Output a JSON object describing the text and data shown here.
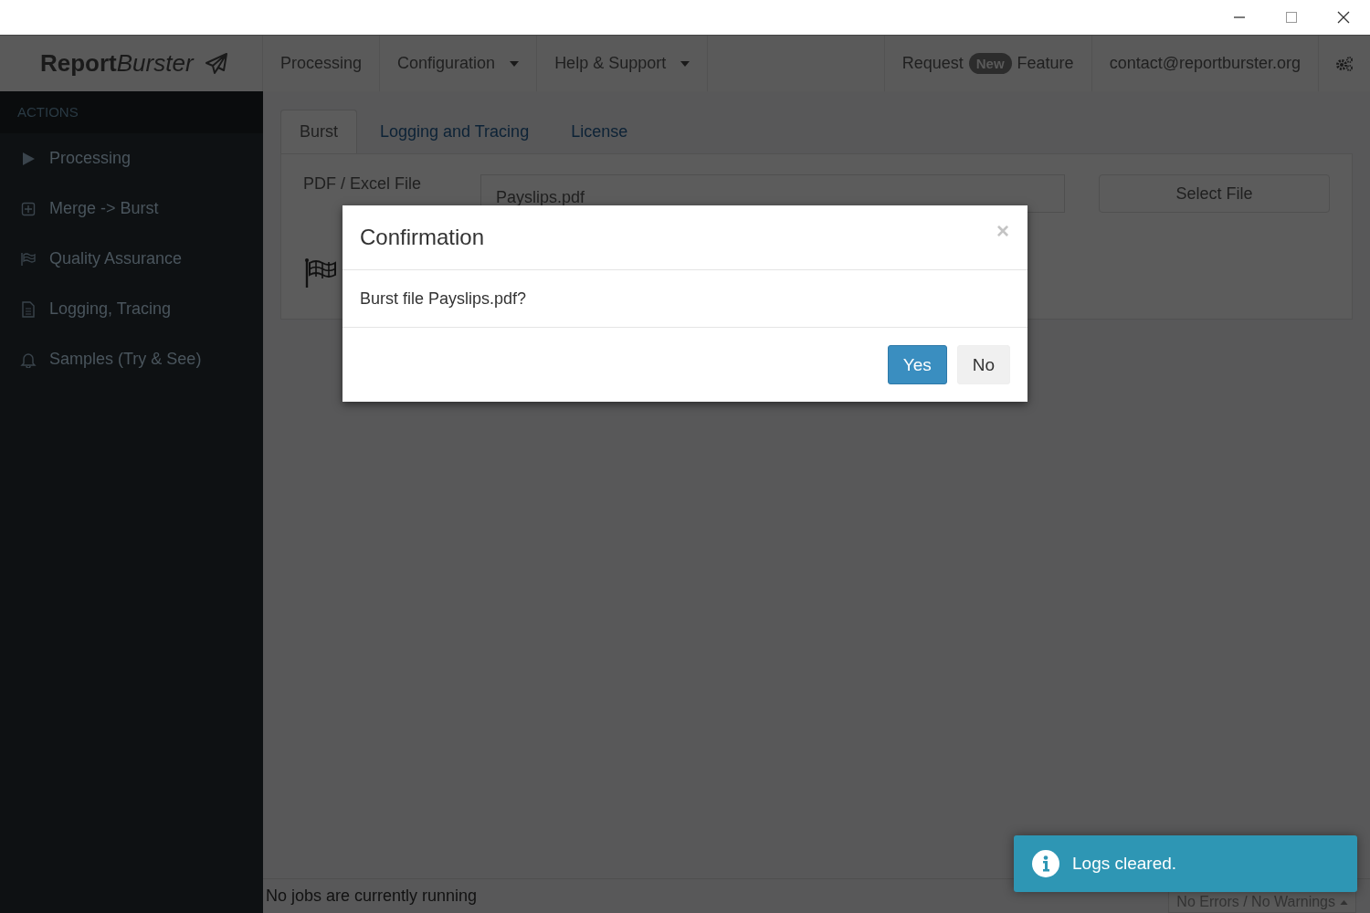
{
  "brand": {
    "bold": "Report",
    "italic": "Burster"
  },
  "nav": [
    {
      "label": "Processing",
      "dropdown": false
    },
    {
      "label": "Configuration",
      "dropdown": true
    },
    {
      "label": "Help & Support",
      "dropdown": true
    }
  ],
  "nav_right": {
    "request": "Request",
    "badge": "New",
    "feature": "Feature",
    "email": "contact@reportburster.org"
  },
  "sidebar": {
    "header": "ACTIONS",
    "items": [
      {
        "kind": "play",
        "label": "Processing"
      },
      {
        "kind": "plus",
        "label": "Merge -> Burst"
      },
      {
        "kind": "flag",
        "label": "Quality Assurance"
      },
      {
        "kind": "doc",
        "label": "Logging, Tracing"
      },
      {
        "kind": "bell",
        "label": "Samples (Try & See)"
      }
    ]
  },
  "tabs": [
    {
      "label": "Burst",
      "selected": true
    },
    {
      "label": "Logging and Tracing",
      "selected": false
    },
    {
      "label": "License",
      "selected": false
    }
  ],
  "form": {
    "label": "PDF / Excel File",
    "value": "Payslips.pdf",
    "button": "Select File"
  },
  "dialog": {
    "title": "Confirmation",
    "close": "×",
    "message": "Burst file Payslips.pdf?",
    "buttons": [
      {
        "label": "Yes",
        "primary": true
      },
      {
        "label": "No",
        "primary": false
      }
    ]
  },
  "status_bar": {
    "left": "No jobs are currently running",
    "right": "No Errors / No Warnings"
  },
  "toast": {
    "message": "Logs cleared."
  }
}
